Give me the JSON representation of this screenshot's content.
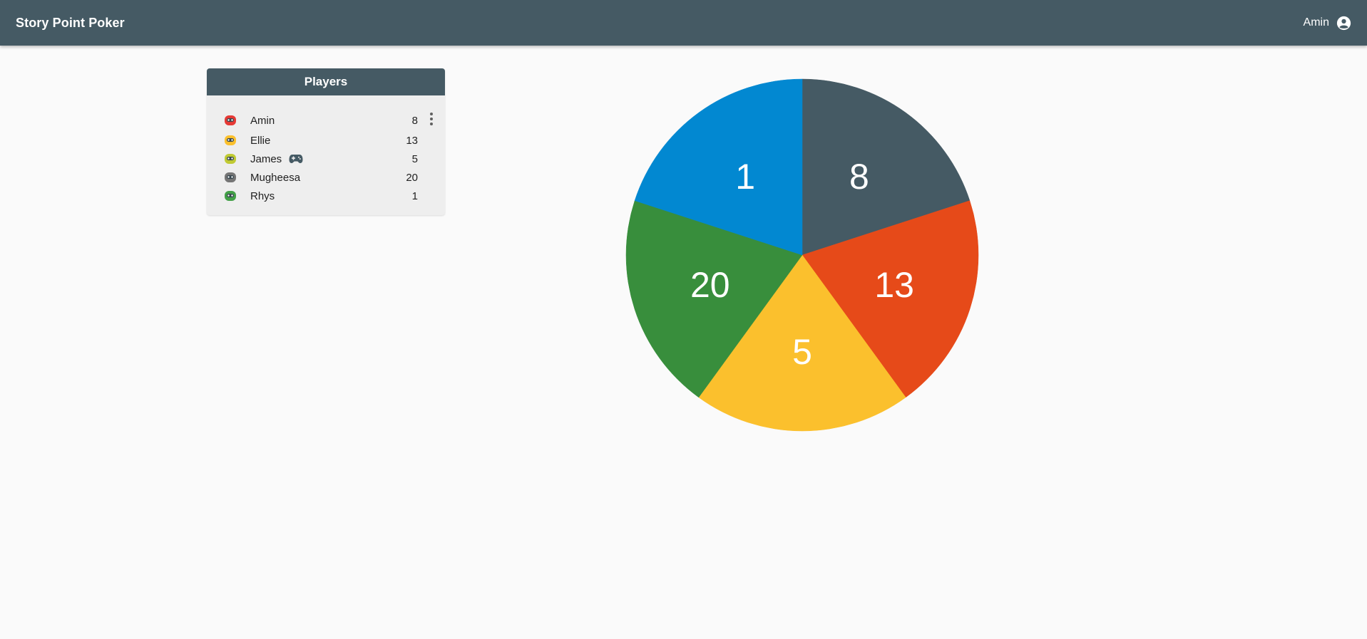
{
  "app": {
    "title": "Story Point Poker",
    "user_name": "Amin",
    "user_icon": "account-circle-icon",
    "appbar_color": "#455a64"
  },
  "players_panel": {
    "title": "Players",
    "players": [
      {
        "name": "Amin",
        "score": "8",
        "avatar_color": "#e53935",
        "badge_icon": "",
        "has_menu": true
      },
      {
        "name": "Ellie",
        "score": "13",
        "avatar_color": "#fbc02d",
        "badge_icon": "",
        "has_menu": false
      },
      {
        "name": "James",
        "score": "5",
        "avatar_color": "#c0ca33",
        "badge_icon": "gamepad-icon",
        "has_menu": false
      },
      {
        "name": "Mugheesa",
        "score": "20",
        "avatar_color": "#757575",
        "badge_icon": "",
        "has_menu": false
      },
      {
        "name": "Rhys",
        "score": "1",
        "avatar_color": "#43a047",
        "badge_icon": "",
        "has_menu": false
      }
    ]
  },
  "chart_data": {
    "type": "pie",
    "title": "",
    "slices": [
      {
        "label": "8",
        "value": 1,
        "color": "#455a64"
      },
      {
        "label": "13",
        "value": 1,
        "color": "#e64a19"
      },
      {
        "label": "5",
        "value": 1,
        "color": "#fbc02d"
      },
      {
        "label": "20",
        "value": 1,
        "color": "#388e3c"
      },
      {
        "label": "1",
        "value": 1,
        "color": "#0288d1"
      }
    ],
    "start_angle_deg": 0,
    "direction": "clockwise",
    "legend": "none"
  }
}
